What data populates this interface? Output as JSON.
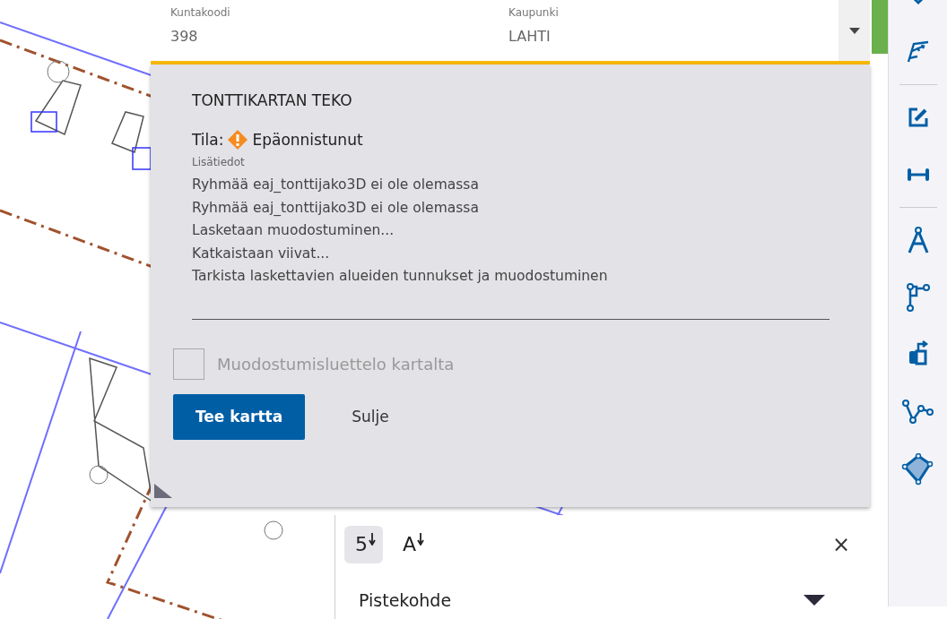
{
  "location_fields": [
    {
      "label": "Kuntakoodi",
      "value": "398"
    },
    {
      "label": "Kaupunki",
      "value": "LAHTI"
    }
  ],
  "dialog": {
    "title": "TONTTIKARTAN TEKO",
    "status_label": "Tila:",
    "status": {
      "text": "Epäonnistunut",
      "kind": "error"
    },
    "details_label": "Lisätiedot",
    "messages": [
      "Ryhmää eaj_tonttijako3D ei ole olemassa",
      "Ryhmää eaj_tonttijako3D ei ole olemassa",
      "Lasketaan muodostuminen...",
      "Katkaistaan viivat...",
      "Tarkista laskettavien alueiden tunnukset ja muodostuminen"
    ],
    "checkbox": {
      "label": "Muodostumisluettelo kartalta",
      "checked": false,
      "disabled": true
    },
    "buttons": [
      {
        "label": "Tee kartta",
        "kind": "primary"
      },
      {
        "label": "Sulje",
        "kind": "plain"
      }
    ]
  },
  "sort_panel": {
    "sort_buttons": [
      {
        "label": "5",
        "selected": true
      },
      {
        "label": "A",
        "selected": false
      }
    ],
    "close": "×",
    "field_label": "Pistekohde"
  },
  "toolbar": [
    {
      "kind": "pin"
    },
    {
      "kind": "angle"
    },
    {
      "kind": "divider"
    },
    {
      "kind": "edit"
    },
    {
      "kind": "measure"
    },
    {
      "kind": "divider"
    },
    {
      "kind": "compass"
    },
    {
      "kind": "branch"
    },
    {
      "kind": "move"
    },
    {
      "kind": "polyline"
    },
    {
      "kind": "polygon"
    }
  ]
}
